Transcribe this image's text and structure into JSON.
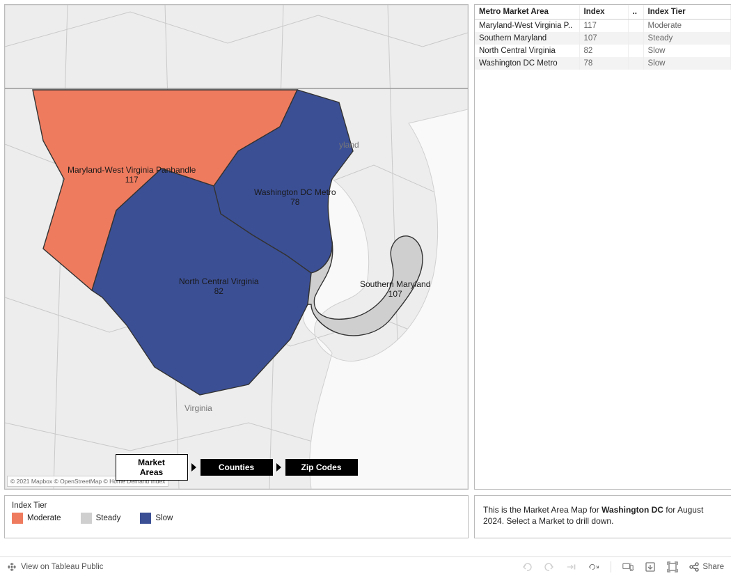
{
  "map": {
    "attribution": "© 2021 Mapbox © OpenStreetMap © Home Demand Index",
    "labels": {
      "mwvp": {
        "name": "Maryland-West Virginia Panhandle",
        "value": "117"
      },
      "dc": {
        "name": "Washington DC Metro",
        "value": "78"
      },
      "ncv": {
        "name": "North Central Virginia",
        "value": "82"
      },
      "smd": {
        "name": "Southern Maryland",
        "value": "107"
      },
      "va_state": "Virginia",
      "md_state": "yland"
    },
    "drill": {
      "market_areas": "Market Areas",
      "counties": "Counties",
      "zip_codes": "Zip Codes"
    }
  },
  "table": {
    "headers": {
      "area": "Metro Market Area",
      "index": "Index",
      "delta": "..",
      "tier": "Index Tier"
    },
    "rows": [
      {
        "area": "Maryland-West Virginia P..",
        "index": "117",
        "tier": "Moderate"
      },
      {
        "area": "Southern Maryland",
        "index": "107",
        "tier": "Steady"
      },
      {
        "area": "North Central Virginia",
        "index": "82",
        "tier": "Slow"
      },
      {
        "area": "Washington DC Metro",
        "index": "78",
        "tier": "Slow"
      }
    ]
  },
  "legend": {
    "title": "Index Tier",
    "items": [
      {
        "label": "Moderate",
        "color": "#ef7b5e"
      },
      {
        "label": "Steady",
        "color": "#cfcfcf"
      },
      {
        "label": "Slow",
        "color": "#3b4f95"
      }
    ]
  },
  "caption": {
    "prefix": "This is the Market Area Map for ",
    "bold": "Washington DC",
    "suffix": " for August 2024.  Select a Market to drill down."
  },
  "toolbar": {
    "view": "View on Tableau Public",
    "share": "Share"
  },
  "colors": {
    "moderate": "#ef7b5e",
    "steady": "#cfcfcf",
    "slow": "#3b4f95",
    "mapbg": "#ededed",
    "road": "#d8d8d8",
    "water": "#f9f9f9",
    "border": "#999"
  }
}
